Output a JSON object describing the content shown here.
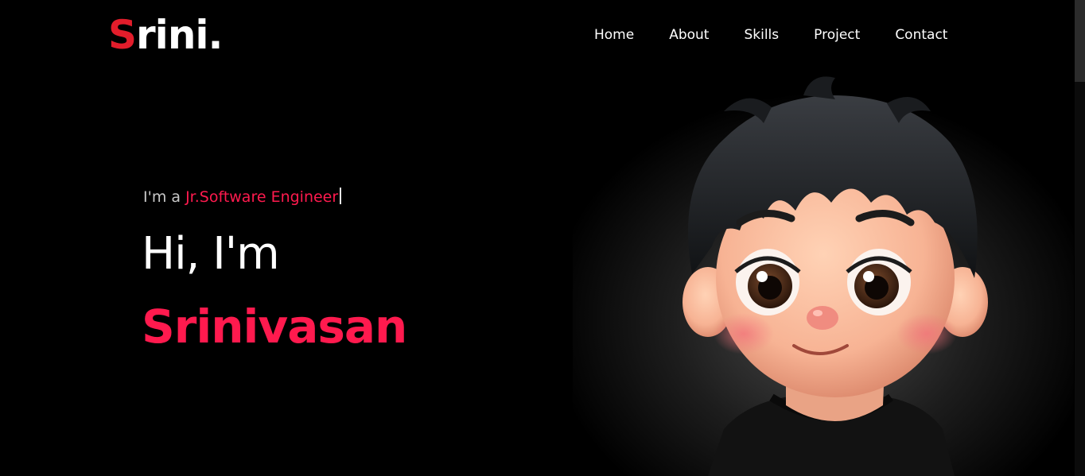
{
  "logo": {
    "first_letter": "S",
    "rest": "rini."
  },
  "nav": {
    "items": [
      {
        "label": "Home"
      },
      {
        "label": "About"
      },
      {
        "label": "Skills"
      },
      {
        "label": "Project"
      },
      {
        "label": "Contact"
      }
    ]
  },
  "hero": {
    "tagline_prefix": "I'm a ",
    "role": "Jr.Software Engineer",
    "greeting": "Hi, I'm",
    "name": "Srinivasan"
  },
  "colors": {
    "background": "#000000",
    "accent": "#ff1a4e",
    "logo_accent": "#e21d2b",
    "text": "#ffffff"
  },
  "icons": {
    "avatar": "cartoon-boy-avatar"
  }
}
